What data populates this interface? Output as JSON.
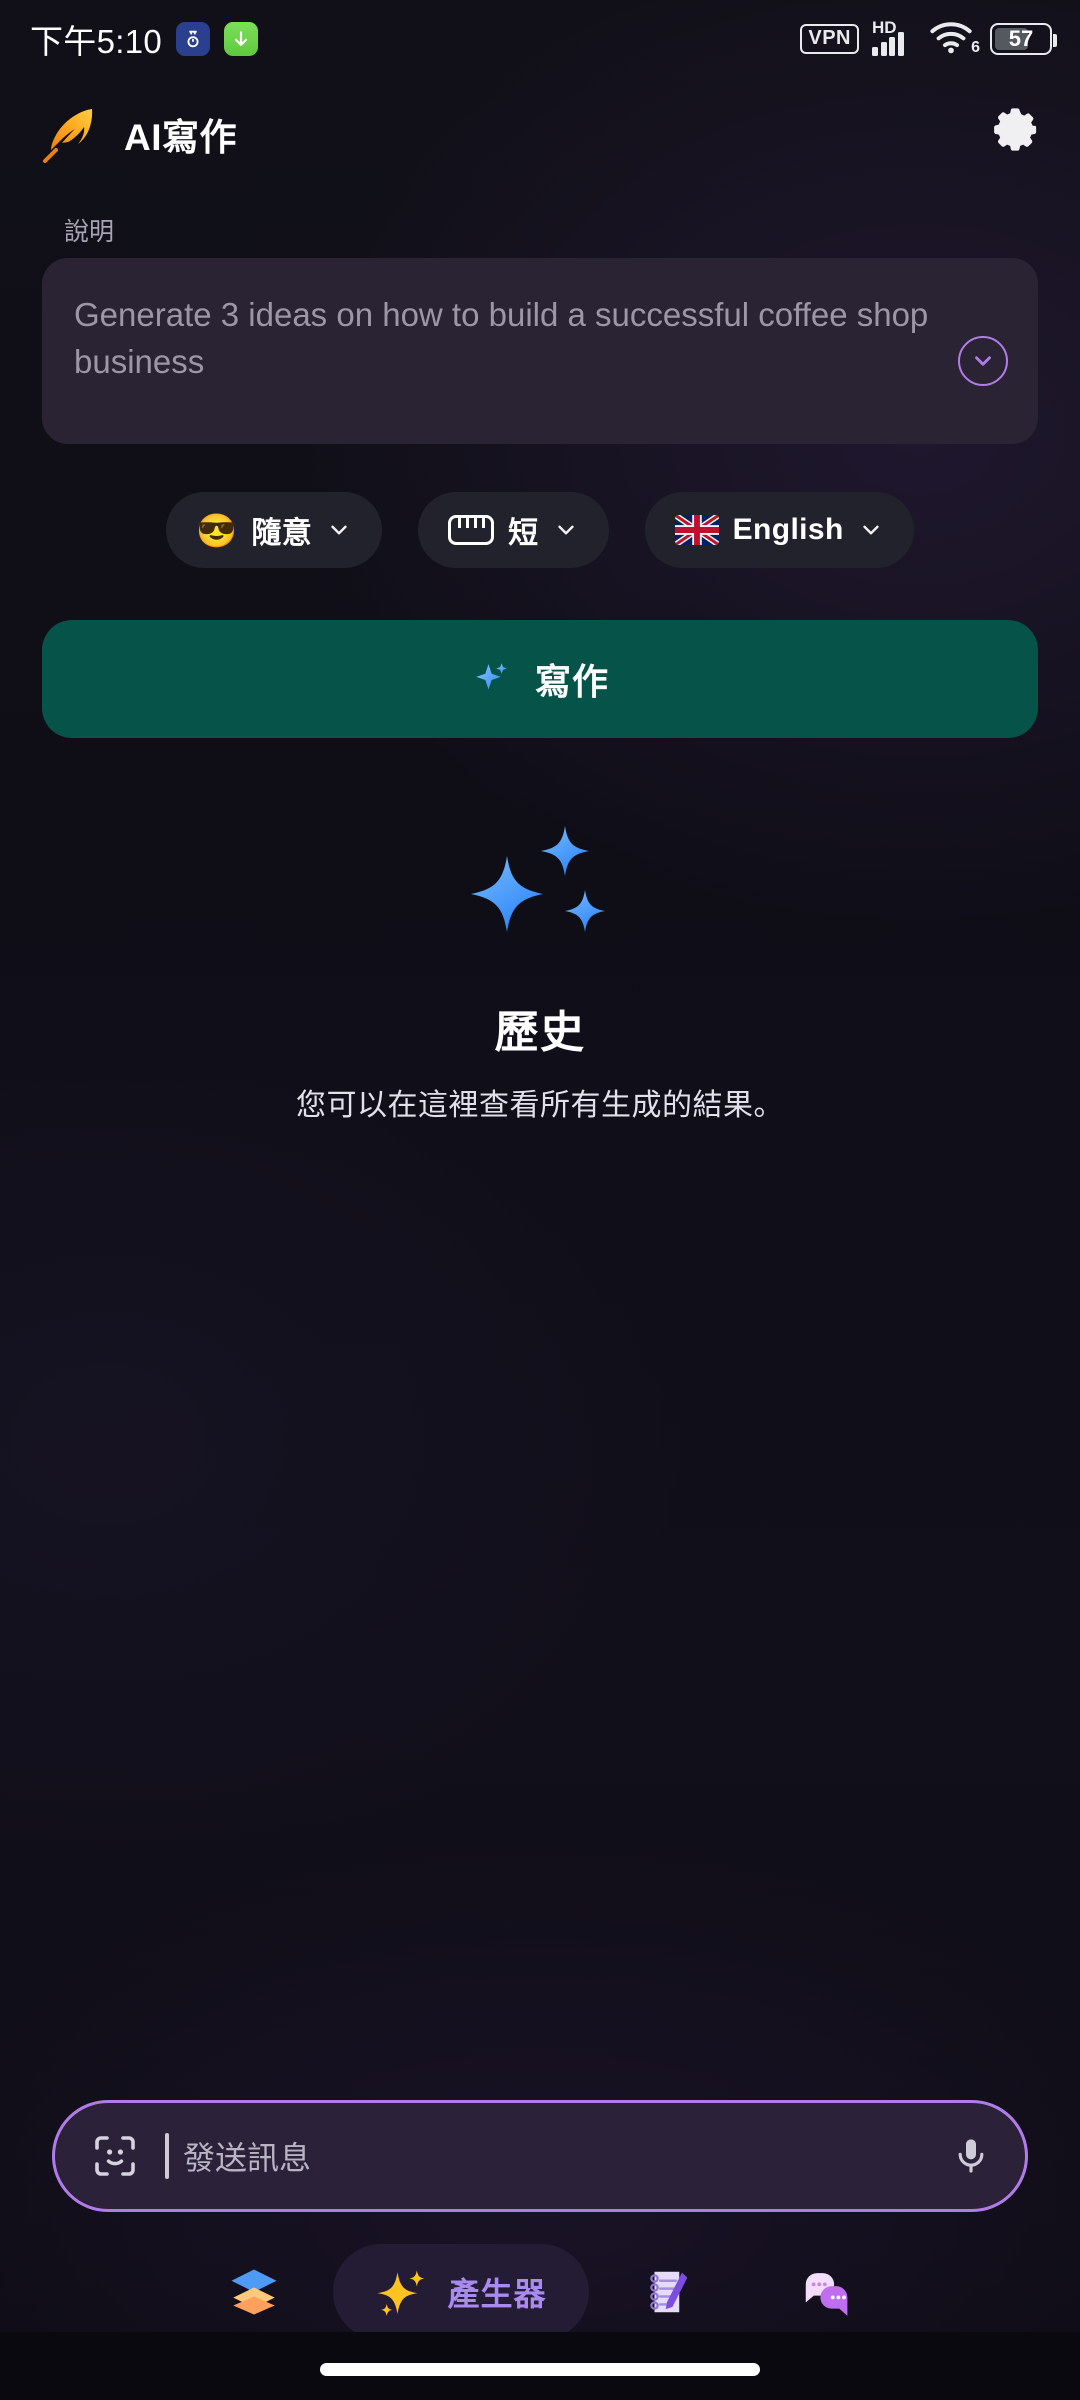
{
  "status_bar": {
    "time": "下午5:10",
    "notification_icons": [
      "calendar-badge-icon",
      "download-badge-icon"
    ],
    "vpn_label": "VPN",
    "network_label": "HD",
    "wifi_generation": "6",
    "battery_percent": "57"
  },
  "header": {
    "logo_icon": "feather-icon",
    "title": "AI寫作",
    "settings_icon": "gear-icon"
  },
  "description": {
    "label": "說明",
    "placeholder": "Generate 3 ideas on how to build a successful coffee shop business",
    "expand_icon": "chevron-down-circle-icon"
  },
  "options": [
    {
      "icon": "sunglasses-emoji",
      "emoji": "😎",
      "label": "隨意",
      "chevron": "chevron-down-icon"
    },
    {
      "icon": "ruler-icon",
      "emoji": "",
      "label": "短",
      "chevron": "chevron-down-icon"
    },
    {
      "icon": "uk-flag-icon",
      "emoji": "",
      "label": "English",
      "chevron": "chevron-down-icon"
    }
  ],
  "primary_action": {
    "icon": "sparkle-icon",
    "label": "寫作",
    "color": "#065449"
  },
  "empty_state": {
    "icon": "sparkles-icon",
    "title": "歷史",
    "subtitle": "您可以在這裡查看所有生成的結果。"
  },
  "message_input": {
    "left_icon": "scan-face-icon",
    "placeholder": "發送訊息",
    "right_icon": "microphone-icon",
    "border_color": "#b07de8"
  },
  "bottom_nav": [
    {
      "icon": "layers-icon",
      "label": "",
      "active": false
    },
    {
      "icon": "sparkle-icon",
      "label": "產生器",
      "active": true
    },
    {
      "icon": "notepad-pencil-icon",
      "label": "",
      "active": false
    },
    {
      "icon": "chat-bubbles-icon",
      "label": "",
      "active": false
    }
  ],
  "theme": {
    "background": "#0d0c14",
    "card_background": "#2a2334",
    "accent_purple": "#b07de8",
    "accent_teal": "#065449",
    "nav_active_text": "#a98aee"
  }
}
